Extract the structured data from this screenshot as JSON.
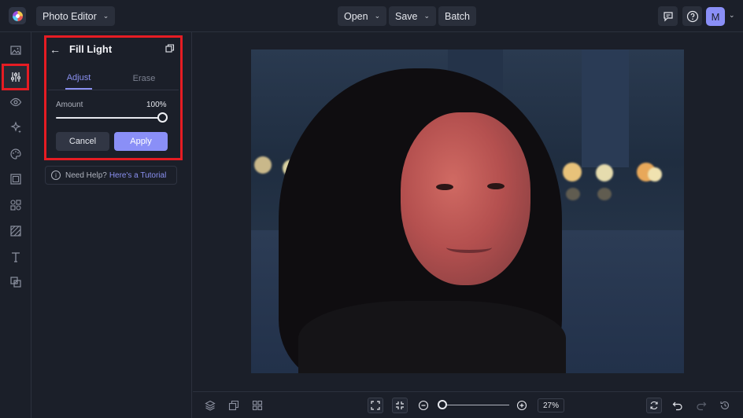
{
  "header": {
    "app_menu_label": "Photo Editor",
    "open_label": "Open",
    "save_label": "Save",
    "batch_label": "Batch",
    "avatar_initial": "M"
  },
  "rail": {
    "items": [
      "image-icon",
      "sliders-icon",
      "eye-icon",
      "sparkle-icon",
      "palette-icon",
      "frame-icon",
      "shapes-icon",
      "texture-icon",
      "text-icon",
      "overlay-icon"
    ],
    "active": "sliders-icon"
  },
  "panel": {
    "title": "Fill Light",
    "tabs": [
      {
        "label": "Adjust",
        "active": true
      },
      {
        "label": "Erase",
        "active": false
      }
    ],
    "amount_label": "Amount",
    "amount_value": "100%",
    "amount_fraction": 1.0,
    "cancel_label": "Cancel",
    "apply_label": "Apply",
    "help_text": "Need Help?",
    "help_link": "Here's a Tutorial"
  },
  "bottom": {
    "zoom_value": "27%",
    "zoom_fraction": 0.0
  },
  "colors": {
    "accent": "#8a8ff7",
    "highlight": "#e51c23",
    "background": "#1b1f29"
  }
}
